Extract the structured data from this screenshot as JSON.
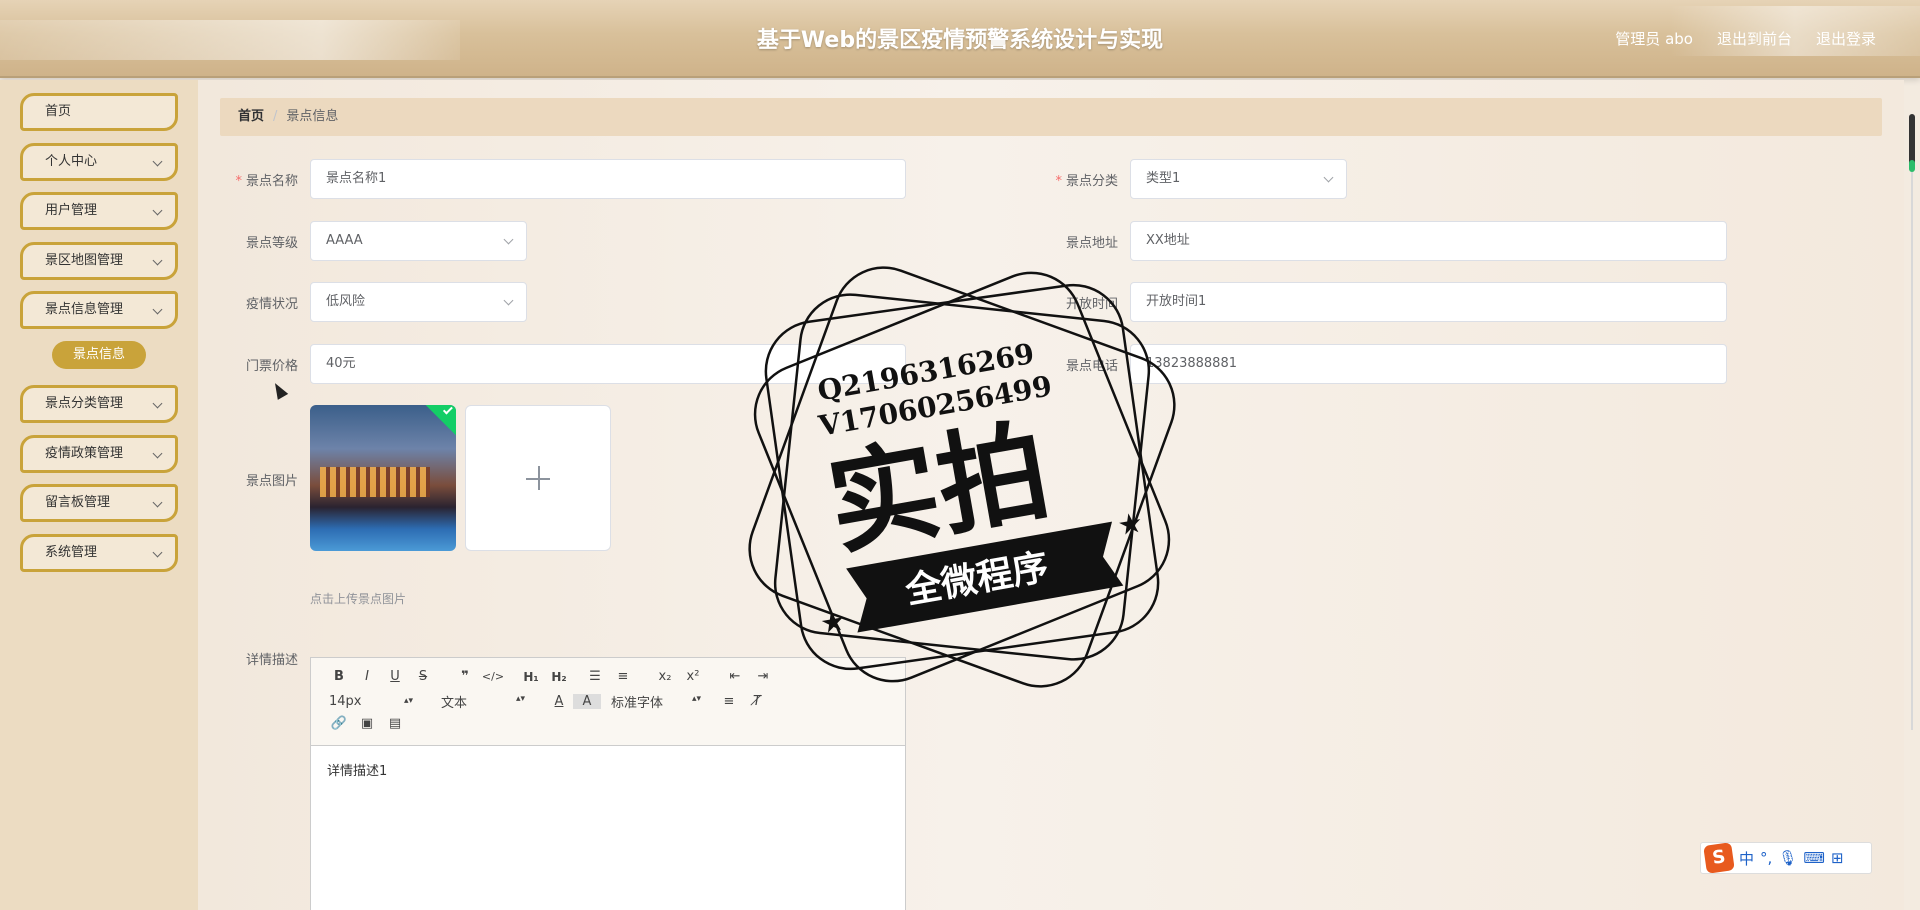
{
  "header": {
    "title": "基于Web的景区疫情预警系统设计与实现",
    "admin": "管理员 abo",
    "to_front": "退出到前台",
    "logout": "退出登录"
  },
  "sidebar": {
    "items": [
      {
        "label": "首页"
      },
      {
        "label": "个人中心"
      },
      {
        "label": "用户管理"
      },
      {
        "label": "景区地图管理"
      },
      {
        "label": "景点信息管理"
      },
      {
        "label": "景点分类管理"
      },
      {
        "label": "疫情政策管理"
      },
      {
        "label": "留言板管理"
      },
      {
        "label": "系统管理"
      }
    ],
    "active_sub": "景点信息"
  },
  "breadcrumb": {
    "home": "首页",
    "separator": "/",
    "current": "景点信息"
  },
  "form": {
    "name_label": "景点名称",
    "name_value": "景点名称1",
    "category_label": "景点分类",
    "category_value": "类型1",
    "level_label": "景点等级",
    "level_value": "AAAA",
    "address_label": "景点地址",
    "address_value": "XX地址",
    "status_label": "疫情状况",
    "status_value": "低风险",
    "open_label": "开放时间",
    "open_value": "开放时间1",
    "price_label": "门票价格",
    "price_value": "40元",
    "phone_label": "景点电话",
    "phone_value": "13823888881",
    "image_label": "景点图片",
    "upload_tip": "点击上传景点图片",
    "desc_label": "详情描述",
    "desc_value": "详情描述1",
    "required_mark": "*"
  },
  "editor": {
    "font_size": "14px",
    "paragraph": "文本",
    "font_family": "标准字体"
  },
  "stamp": {
    "line1": "Q2196316269",
    "line2": "V17060256499",
    "main": "实拍",
    "ribbon": "全微程序"
  },
  "ime": {
    "lang": "中",
    "punct": "°,"
  }
}
